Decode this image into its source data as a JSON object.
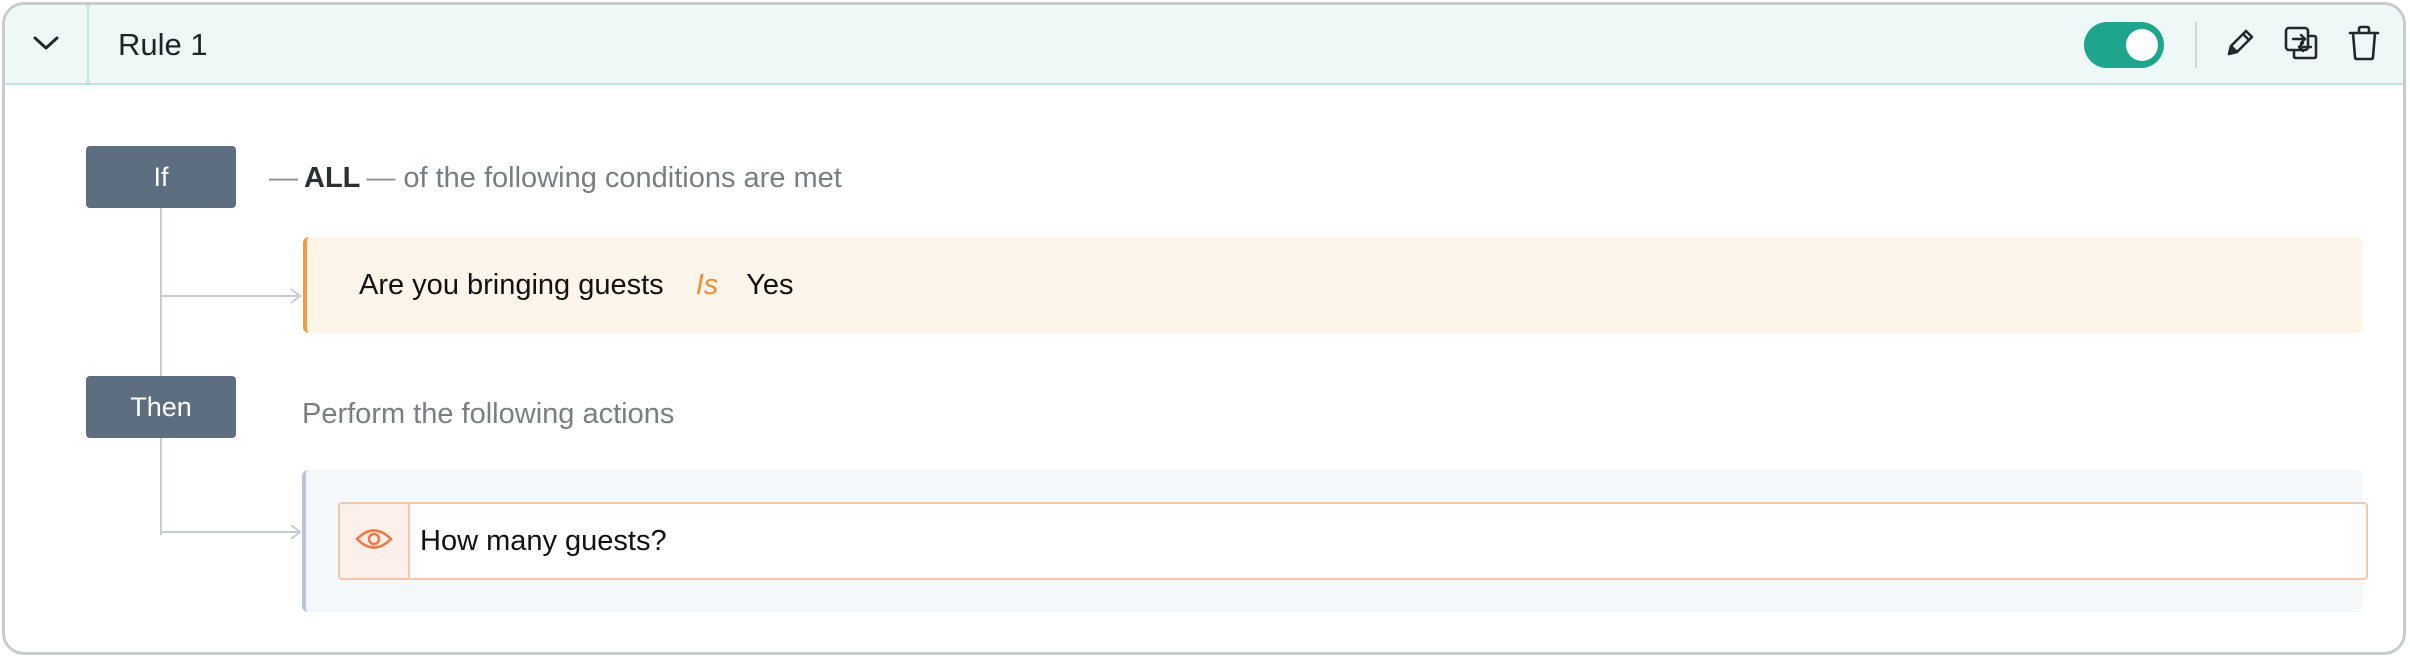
{
  "rule": {
    "title": "Rule 1",
    "enabled": true
  },
  "header_icons": {
    "collapse": "chevron-down-icon",
    "edit": "pencil-icon",
    "duplicate": "duplicate-icon",
    "delete": "trash-icon"
  },
  "conditions": {
    "badge": "If",
    "dash_left": "—",
    "quantifier": "ALL",
    "dash_right": "—",
    "description": "of the following conditions are met",
    "items": [
      {
        "field": "Are you bringing guests",
        "operator": "Is",
        "value": "Yes"
      }
    ]
  },
  "actions": {
    "badge": "Then",
    "description": "Perform the following actions",
    "items": [
      {
        "icon": "eye-icon",
        "label": "How many guests?"
      }
    ]
  },
  "colors": {
    "header_bg": "#eef8f6",
    "toggle_on": "#1fa58e",
    "badge_bg": "#5d6e80",
    "condition_accent": "#f29a44",
    "condition_bg": "#fdf4ea",
    "action_bg": "#f5f8fb",
    "action_icon": "#ef7a45"
  }
}
